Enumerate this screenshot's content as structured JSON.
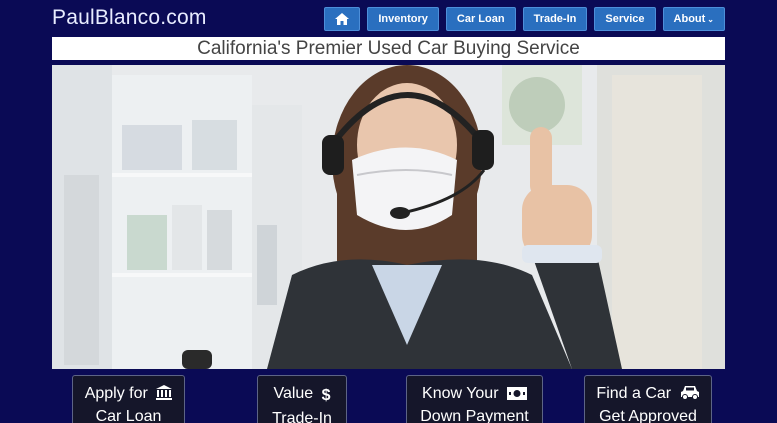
{
  "header": {
    "logo_text": "PaulBlanco.com"
  },
  "nav": {
    "home_icon": "home-icon",
    "items": [
      {
        "label": "Inventory"
      },
      {
        "label": "Car Loan"
      },
      {
        "label": "Trade-In"
      },
      {
        "label": "Service"
      },
      {
        "label": "About"
      }
    ]
  },
  "tagline": "California's Premier Used Car Buying Service",
  "hero": {
    "image_subject": "photo-of-masked-agent-thumbs-up"
  },
  "cta": [
    {
      "line1": "Apply for",
      "line2": "Car Loan",
      "icon": "bank-icon"
    },
    {
      "line1": "Value",
      "line2": "Trade-In",
      "icon": "dollar-icon"
    },
    {
      "line1": "Know Your",
      "line2": "Down Payment",
      "icon": "cash-icon"
    },
    {
      "line1": "Find a Car",
      "line2": "Get Approved",
      "icon": "car-icon"
    }
  ],
  "colors": {
    "background": "#0a0a55",
    "nav_button": "#2a6fbf",
    "cta_background": "#15162a"
  }
}
